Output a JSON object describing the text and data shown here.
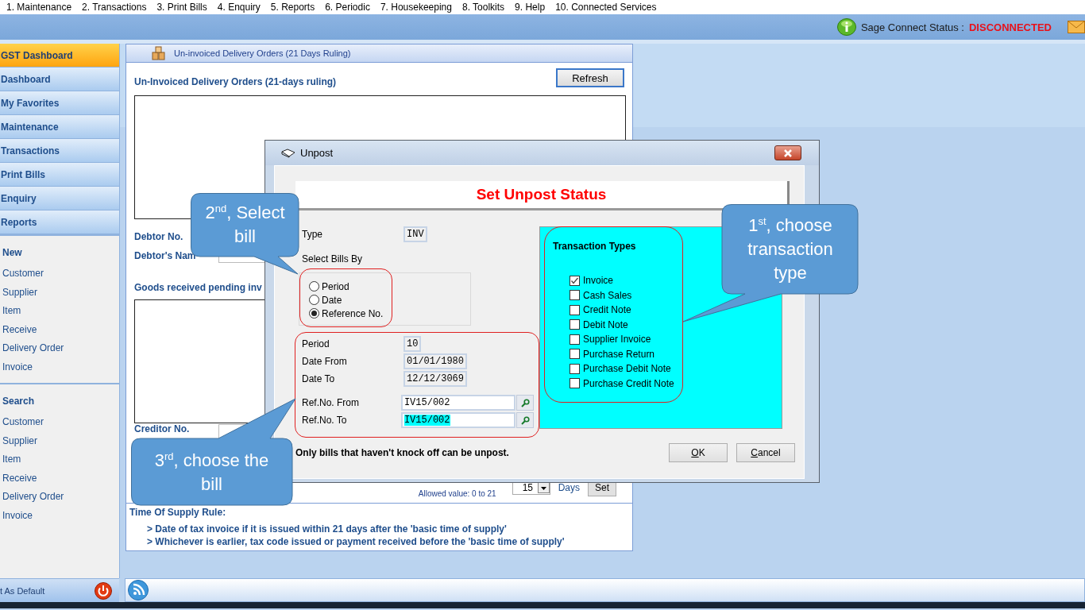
{
  "menu_bar": [
    "1. Maintenance",
    "2. Transactions",
    "3. Print Bills",
    "4. Enquiry",
    "5. Reports",
    "6. Periodic",
    "7. Housekeeping",
    "8. Toolkits",
    "9. Help",
    "10. Connected Services"
  ],
  "connect_status": {
    "label": "Sage Connect Status :",
    "value": "DISCONNECTED"
  },
  "sidebar": {
    "nav": [
      {
        "label": "GST Dashboard",
        "selected": true
      },
      {
        "label": "Dashboard",
        "selected": false
      },
      {
        "label": "My Favorites",
        "selected": false
      },
      {
        "label": "Maintenance",
        "selected": false
      },
      {
        "label": "Transactions",
        "selected": false
      },
      {
        "label": "Print Bills",
        "selected": false
      },
      {
        "label": "Enquiry",
        "selected": false
      },
      {
        "label": "Reports",
        "selected": false
      }
    ],
    "sections": [
      {
        "title": "New",
        "items": [
          "Customer",
          "Supplier",
          "Item",
          "Receive",
          "Delivery Order",
          "Invoice"
        ]
      },
      {
        "title": "Search",
        "items": [
          "Customer",
          "Supplier",
          "Item",
          "Receive",
          "Delivery Order",
          "Invoice"
        ]
      }
    ],
    "footer": "t As Default"
  },
  "panel": {
    "tab": "Un-invoiced Delivery Orders (21 Days Ruling)",
    "heading": "Un-Invoiced Delivery Orders (21-days ruling)",
    "refresh": "Refresh",
    "debtor_no": "Debtor No.",
    "debtor_name": "Debtor's Nam",
    "goods_heading": "Goods received pending inv",
    "creditor_no": "Creditor No.",
    "allowed": "Allowed value: 0 to 21",
    "threshold": "15",
    "days": "Days",
    "set": "Set",
    "rule_title": "Time Of Supply Rule:",
    "rules": [
      "> Date of tax invoice if it is issued within 21 days after the 'basic time of supply'",
      "> Whichever is earlier, tax code issued or payment received before the 'basic time of supply'"
    ]
  },
  "dialog": {
    "title": "Unpost",
    "heading": "Set Unpost Status",
    "type_label": "Type",
    "type_value": "INV",
    "select_by_label": "Select Bills By",
    "select_by": [
      {
        "label": "Period",
        "selected": false
      },
      {
        "label": "Date",
        "selected": false
      },
      {
        "label": "Reference No.",
        "selected": true
      }
    ],
    "fields": [
      {
        "label": "Period",
        "value": "10",
        "kind": "short",
        "text_selected": false
      },
      {
        "label": "Date From",
        "value": "01/01/1980",
        "kind": "date",
        "text_selected": false
      },
      {
        "label": "Date To",
        "value": "12/12/3069",
        "kind": "date",
        "text_selected": false
      },
      {
        "label": "Ref.No. From",
        "value": "IV15/002",
        "kind": "lookup",
        "text_selected": false
      },
      {
        "label": "Ref.No. To",
        "value": "IV15/002",
        "kind": "lookup",
        "text_selected": true
      }
    ],
    "transaction_types": {
      "title": "Transaction Types",
      "items": [
        {
          "label": "Invoice",
          "checked": true
        },
        {
          "label": "Cash Sales",
          "checked": false
        },
        {
          "label": "Credit Note",
          "checked": false
        },
        {
          "label": "Debit Note",
          "checked": false
        },
        {
          "label": "Supplier Invoice",
          "checked": false
        },
        {
          "label": "Purchase Return",
          "checked": false
        },
        {
          "label": "Purchase Debit Note",
          "checked": false
        },
        {
          "label": "Purchase Credit Note",
          "checked": false
        }
      ]
    },
    "note": "Only bills that haven't knock off can be unpost.",
    "buttons": [
      "OK",
      "Cancel"
    ]
  },
  "callouts": [
    {
      "kind": "down",
      "text": "2$^{nd}$, Select bill"
    },
    {
      "kind": "left",
      "text": "1$^{st}$, choose transaction type"
    },
    {
      "kind": "up",
      "text": "3$^{rd}$, choose the bill"
    }
  ]
}
